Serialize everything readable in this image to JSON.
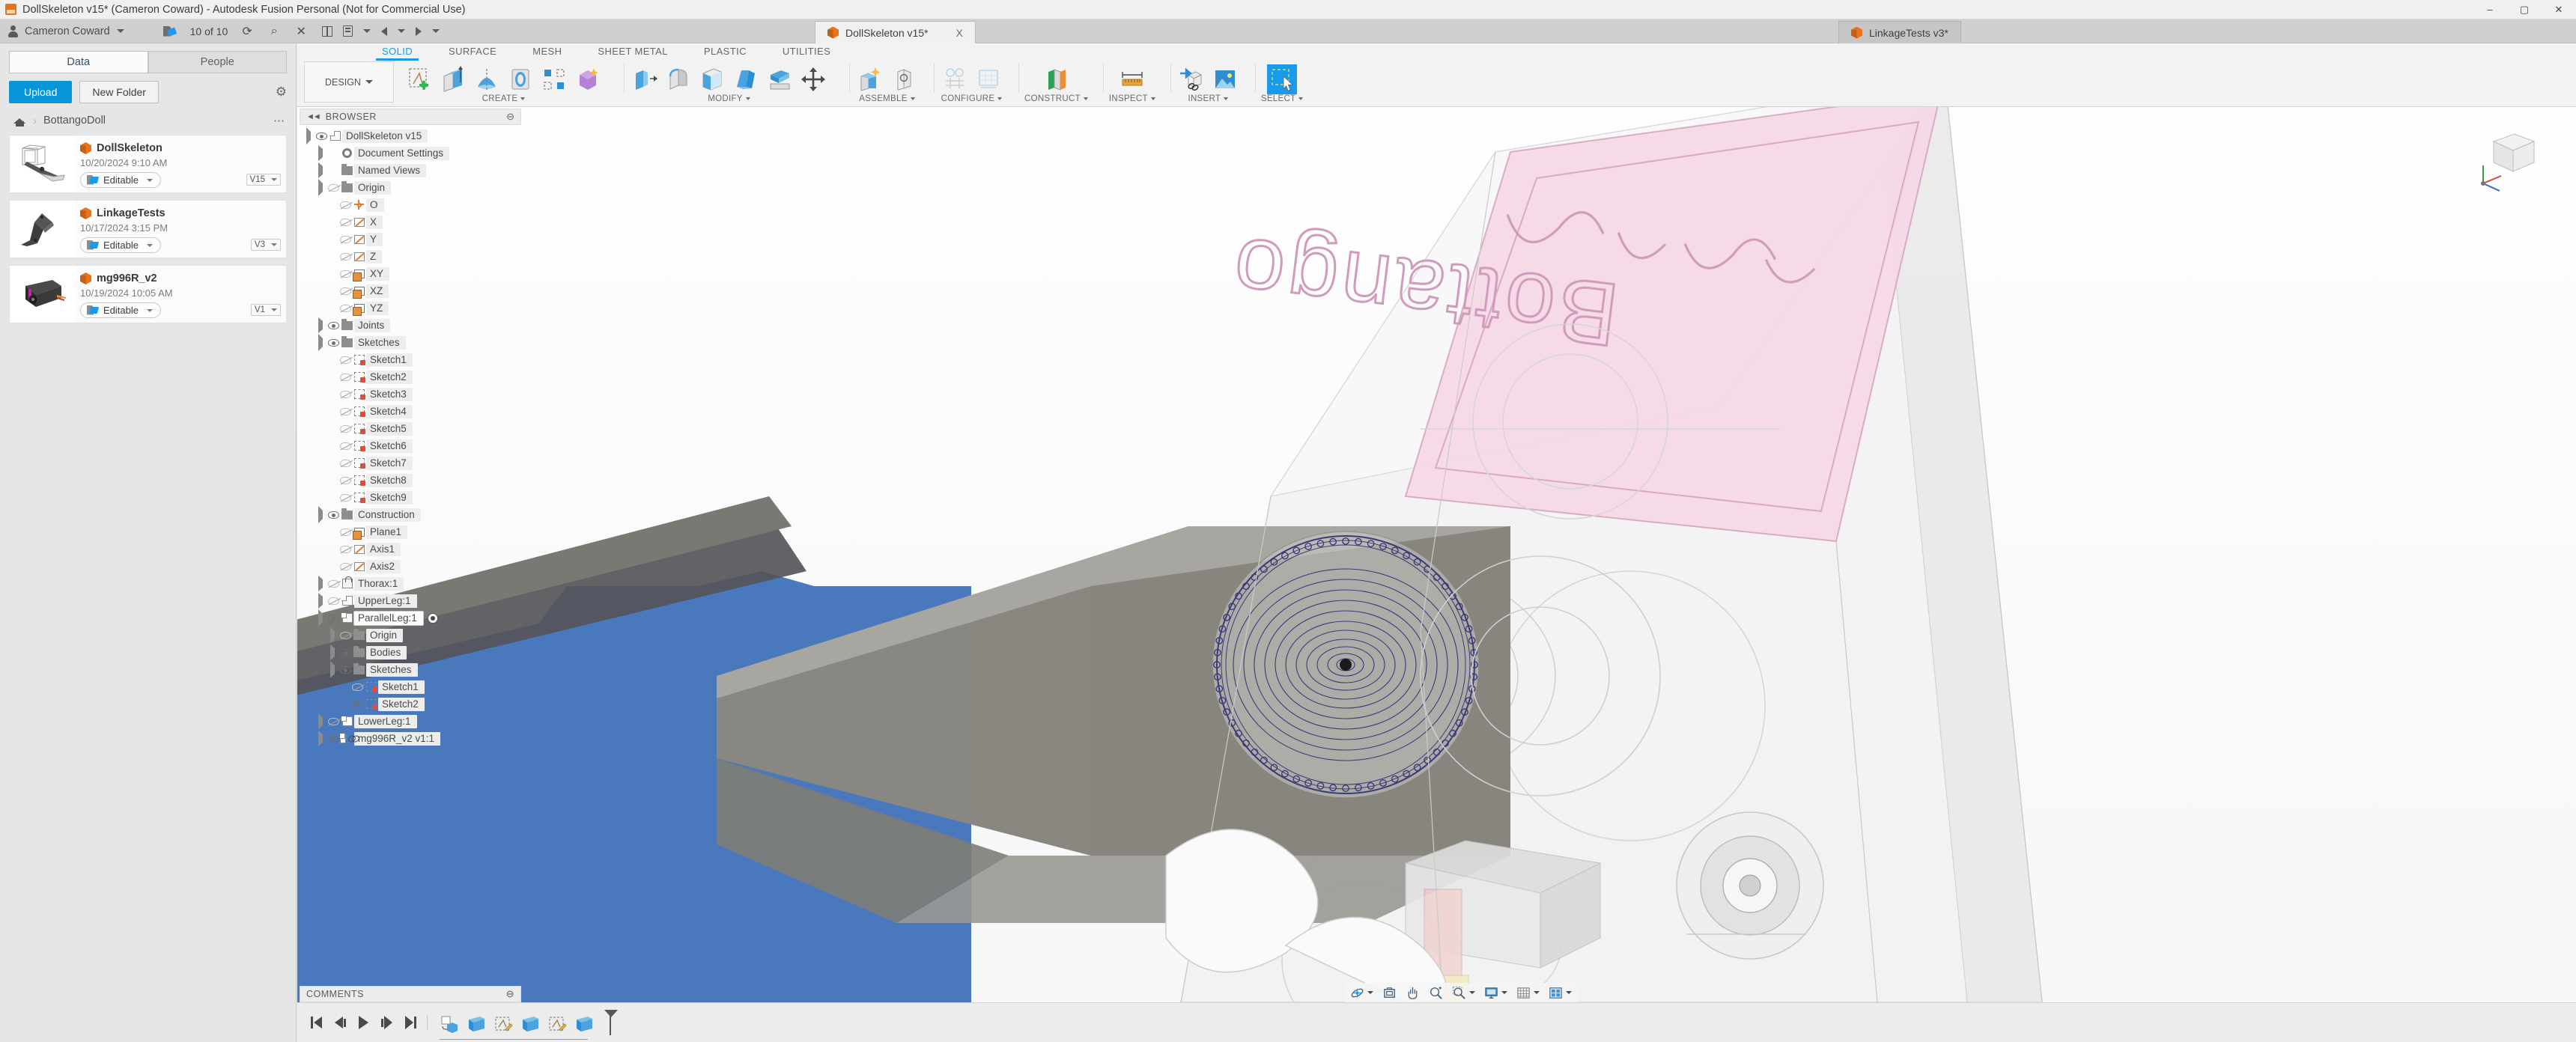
{
  "window": {
    "title": "DollSkeleton v15* (Cameron Coward) - Autodesk Fusion Personal (Not for Commercial Use)",
    "app_icon": "fusion-app-icon",
    "minimize": "–",
    "maximize": "▢",
    "close": "✕"
  },
  "quick_access": {
    "user_name": "Cameron Coward",
    "user_caret": "▾",
    "save_count": "10 of 10",
    "refresh_icon": "refresh-icon",
    "search_icon": "search-icon",
    "close_icon": "✕",
    "grid_icon": "grid-icon",
    "doc_icon": "file-icon",
    "undo_icon": "undo-icon",
    "redo_icon": "redo-icon"
  },
  "doc_tabs": [
    {
      "label": "DollSkeleton v15*",
      "icon": "cube-icon",
      "active": true,
      "close": "X"
    },
    {
      "label": "LinkageTests v3*",
      "icon": "cube-icon",
      "active": false,
      "close": ""
    }
  ],
  "data_panel": {
    "tabs": [
      {
        "label": "Data",
        "selected": true
      },
      {
        "label": "People",
        "selected": false
      }
    ],
    "upload_label": "Upload",
    "new_folder_label": "New Folder",
    "settings_icon": "gear-icon",
    "breadcrumb": {
      "home_icon": "home-icon",
      "chevron": "›",
      "folder": "BottangoDoll",
      "overflow": "⋯"
    },
    "files": [
      {
        "name": "DollSkeleton",
        "date": "10/20/2024 9:10 AM",
        "status": "Editable",
        "version": "V15",
        "thumb": "doll-skeleton-thumb"
      },
      {
        "name": "LinkageTests",
        "date": "10/17/2024 3:15 PM",
        "status": "Editable",
        "version": "V3",
        "thumb": "linkage-thumb"
      },
      {
        "name": "mg996R_v2",
        "date": "10/19/2024 10:05 AM",
        "status": "Editable",
        "version": "V1",
        "thumb": "servo-thumb"
      }
    ]
  },
  "ribbon": {
    "workspace": "DESIGN",
    "workspace_caret": "▾",
    "tabs": [
      {
        "label": "SOLID",
        "active": true
      },
      {
        "label": "SURFACE",
        "active": false
      },
      {
        "label": "MESH",
        "active": false
      },
      {
        "label": "SHEET METAL",
        "active": false
      },
      {
        "label": "PLASTIC",
        "active": false
      },
      {
        "label": "UTILITIES",
        "active": false
      }
    ],
    "groups": [
      {
        "label": "CREATE",
        "caret": "▾",
        "icons": [
          "create-sketch-icon",
          "extrude-icon",
          "revolve-icon",
          "sweep-icon",
          "pattern-icon",
          "form-icon"
        ]
      },
      {
        "label": "MODIFY",
        "caret": "▾",
        "icons": [
          "press-pull-icon",
          "fillet-icon",
          "shell-icon",
          "draft-icon",
          "split-face-icon",
          "move-copy-icon"
        ]
      },
      {
        "label": "ASSEMBLE",
        "caret": "▾",
        "icons": [
          "new-component-icon",
          "joint-icon"
        ]
      },
      {
        "label": "CONFIGURE",
        "caret": "▾",
        "icons": [
          "configure-icon",
          "configure-table-icon"
        ]
      },
      {
        "label": "CONSTRUCT",
        "caret": "▾",
        "icons": [
          "offset-plane-icon"
        ]
      },
      {
        "label": "INSPECT",
        "caret": "▾",
        "icons": [
          "measure-icon"
        ]
      },
      {
        "label": "INSERT",
        "caret": "▾",
        "icons": [
          "insert-derive-icon",
          "insert-image-icon"
        ]
      },
      {
        "label": "SELECT",
        "caret": "▾",
        "icons": [
          "select-window-icon"
        ]
      }
    ]
  },
  "browser": {
    "title": "BROWSER",
    "collapse_icon": "◄◄",
    "minimize_icon": "⊖",
    "nodes": [
      {
        "label": "DollSkeleton v15",
        "indent": 0,
        "expander": "down",
        "eye": "open",
        "icon": "document-icon"
      },
      {
        "label": "Document Settings",
        "indent": 1,
        "expander": "right",
        "eye": "none",
        "icon": "gear-icon"
      },
      {
        "label": "Named Views",
        "indent": 1,
        "expander": "right",
        "eye": "none",
        "icon": "folder-icon"
      },
      {
        "label": "Origin",
        "indent": 1,
        "expander": "down",
        "eye": "off",
        "icon": "folder-icon"
      },
      {
        "label": "O",
        "indent": 2,
        "expander": "none",
        "eye": "off",
        "icon": "origin-point-icon"
      },
      {
        "label": "X",
        "indent": 2,
        "expander": "none",
        "eye": "off",
        "icon": "axis-icon"
      },
      {
        "label": "Y",
        "indent": 2,
        "expander": "none",
        "eye": "off",
        "icon": "axis-icon"
      },
      {
        "label": "Z",
        "indent": 2,
        "expander": "none",
        "eye": "off",
        "icon": "axis-icon"
      },
      {
        "label": "XY",
        "indent": 2,
        "expander": "none",
        "eye": "off",
        "icon": "plane-icon"
      },
      {
        "label": "XZ",
        "indent": 2,
        "expander": "none",
        "eye": "off",
        "icon": "plane-icon"
      },
      {
        "label": "YZ",
        "indent": 2,
        "expander": "none",
        "eye": "off",
        "icon": "plane-icon"
      },
      {
        "label": "Joints",
        "indent": 1,
        "expander": "right",
        "eye": "open",
        "icon": "folder-icon"
      },
      {
        "label": "Sketches",
        "indent": 1,
        "expander": "down",
        "eye": "open",
        "icon": "folder-icon"
      },
      {
        "label": "Sketch1",
        "indent": 2,
        "expander": "none",
        "eye": "off",
        "icon": "sketch-icon"
      },
      {
        "label": "Sketch2",
        "indent": 2,
        "expander": "none",
        "eye": "off",
        "icon": "sketch-icon"
      },
      {
        "label": "Sketch3",
        "indent": 2,
        "expander": "none",
        "eye": "off",
        "icon": "sketch-icon"
      },
      {
        "label": "Sketch4",
        "indent": 2,
        "expander": "none",
        "eye": "off",
        "icon": "sketch-icon"
      },
      {
        "label": "Sketch5",
        "indent": 2,
        "expander": "none",
        "eye": "off",
        "icon": "sketch-icon"
      },
      {
        "label": "Sketch6",
        "indent": 2,
        "expander": "none",
        "eye": "off",
        "icon": "sketch-icon"
      },
      {
        "label": "Sketch7",
        "indent": 2,
        "expander": "none",
        "eye": "off",
        "icon": "sketch-icon"
      },
      {
        "label": "Sketch8",
        "indent": 2,
        "expander": "none",
        "eye": "off",
        "icon": "sketch-icon"
      },
      {
        "label": "Sketch9",
        "indent": 2,
        "expander": "none",
        "eye": "off",
        "icon": "sketch-icon"
      },
      {
        "label": "Construction",
        "indent": 1,
        "expander": "down",
        "eye": "open",
        "icon": "folder-icon"
      },
      {
        "label": "Plane1",
        "indent": 2,
        "expander": "none",
        "eye": "off",
        "icon": "plane-icon"
      },
      {
        "label": "Axis1",
        "indent": 2,
        "expander": "none",
        "eye": "off",
        "icon": "axis-icon"
      },
      {
        "label": "Axis2",
        "indent": 2,
        "expander": "none",
        "eye": "off",
        "icon": "axis-icon"
      },
      {
        "label": "Thorax:1",
        "indent": 1,
        "expander": "right",
        "eye": "off",
        "icon": "joint-component-icon"
      },
      {
        "label": "UpperLeg:1",
        "indent": 1,
        "expander": "right",
        "eye": "off",
        "icon": "component-icon"
      },
      {
        "label": "ParallelLeg:1",
        "indent": 1,
        "expander": "down",
        "eye": "open",
        "icon": "component-icon",
        "active": true
      },
      {
        "label": "Origin",
        "indent": 2,
        "expander": "right",
        "eye": "off",
        "icon": "folder-icon"
      },
      {
        "label": "Bodies",
        "indent": 2,
        "expander": "right",
        "eye": "open",
        "icon": "folder-icon"
      },
      {
        "label": "Sketches",
        "indent": 2,
        "expander": "down",
        "eye": "open",
        "icon": "folder-icon"
      },
      {
        "label": "Sketch1",
        "indent": 3,
        "expander": "none",
        "eye": "off",
        "icon": "sketch-icon"
      },
      {
        "label": "Sketch2",
        "indent": 3,
        "expander": "none",
        "eye": "open",
        "icon": "sketch-icon"
      },
      {
        "label": "LowerLeg:1",
        "indent": 1,
        "expander": "right",
        "eye": "off",
        "icon": "component-icon"
      },
      {
        "label": "mg996R_v2 v1:1",
        "indent": 1,
        "expander": "right",
        "eye": "open",
        "icon": "linked-component-icon"
      }
    ]
  },
  "comments": {
    "title": "COMMENTS",
    "minimize_icon": "⊖"
  },
  "nav_bar": {
    "items": [
      {
        "icon": "orbit-icon",
        "caret": "▾"
      },
      {
        "icon": "look-at-icon",
        "caret": ""
      },
      {
        "icon": "pan-icon",
        "caret": ""
      },
      {
        "icon": "zoom-icon",
        "caret": ""
      },
      {
        "icon": "zoom-window-icon",
        "caret": "▾"
      },
      {
        "icon": "display-settings-icon",
        "caret": "▾"
      },
      {
        "icon": "grid-snap-icon",
        "caret": "▾"
      },
      {
        "icon": "viewports-icon",
        "caret": "▾"
      }
    ]
  },
  "timeline": {
    "controls": [
      {
        "icon": "go-to-beginning-icon"
      },
      {
        "icon": "step-back-icon"
      },
      {
        "icon": "play-icon"
      },
      {
        "icon": "step-forward-icon"
      },
      {
        "icon": "go-to-end-icon"
      }
    ],
    "features": [
      {
        "icon": "new-component-feature"
      },
      {
        "icon": "extrude-feature"
      },
      {
        "icon": "sketch-feature"
      },
      {
        "icon": "extrude-feature-2"
      },
      {
        "icon": "sketch-feature-2"
      },
      {
        "icon": "extrude-feature-3"
      }
    ],
    "marker": "timeline-marker"
  },
  "viewport": {
    "view_cube": "view-cube",
    "axis_indicator": "axis-triad",
    "model_name": "DollSkeleton"
  },
  "colors": {
    "accent": "#1a9bea",
    "orange": "#e8731c",
    "selection_blue": "#4a78bd",
    "pink_face": "#f6d7e6",
    "panel_bg": "#e6e6e6"
  }
}
